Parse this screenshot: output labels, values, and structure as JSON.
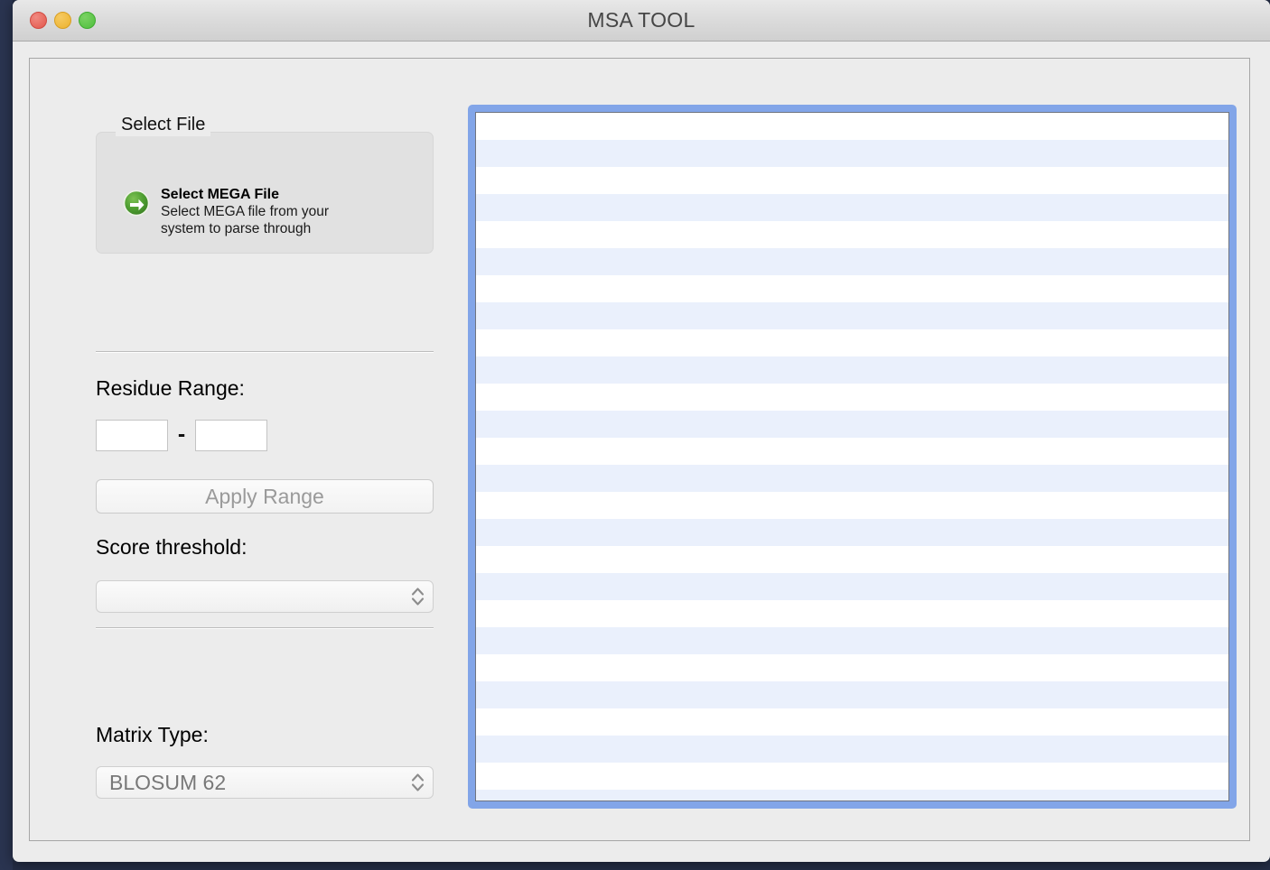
{
  "window": {
    "title": "MSA TOOL",
    "traffic_lights": [
      {
        "name": "close",
        "color": "#e2564b"
      },
      {
        "name": "minimize",
        "color": "#ecb22e"
      },
      {
        "name": "maximize",
        "color": "#4fbf3d"
      }
    ]
  },
  "left_panel": {
    "select_file_group": {
      "legend": "Select File",
      "icon": "green-arrow-right-icon",
      "action_title": "Select MEGA File",
      "action_description": "Select MEGA file from your system to parse through"
    },
    "residue_range": {
      "label": "Residue Range:",
      "start_value": "",
      "start_placeholder": "",
      "separator": "-",
      "end_value": "",
      "end_placeholder": "",
      "apply_button_label": "Apply Range",
      "apply_button_enabled": false
    },
    "score_threshold": {
      "label": "Score threshold:",
      "value": "",
      "stepper_icon": "chevron-up-down-icon"
    },
    "matrix_type": {
      "label": "Matrix Type:",
      "value": "BLOSUM 62",
      "stepper_icon": "chevron-up-down-icon"
    }
  },
  "table_view": {
    "name": "alignment-table",
    "rows": [],
    "row_count": 26,
    "empty": true,
    "focused": true,
    "stripe_colors": {
      "odd": "#ffffff",
      "even": "#eaf0fc"
    },
    "focus_ring_color": "#82a5e8"
  }
}
